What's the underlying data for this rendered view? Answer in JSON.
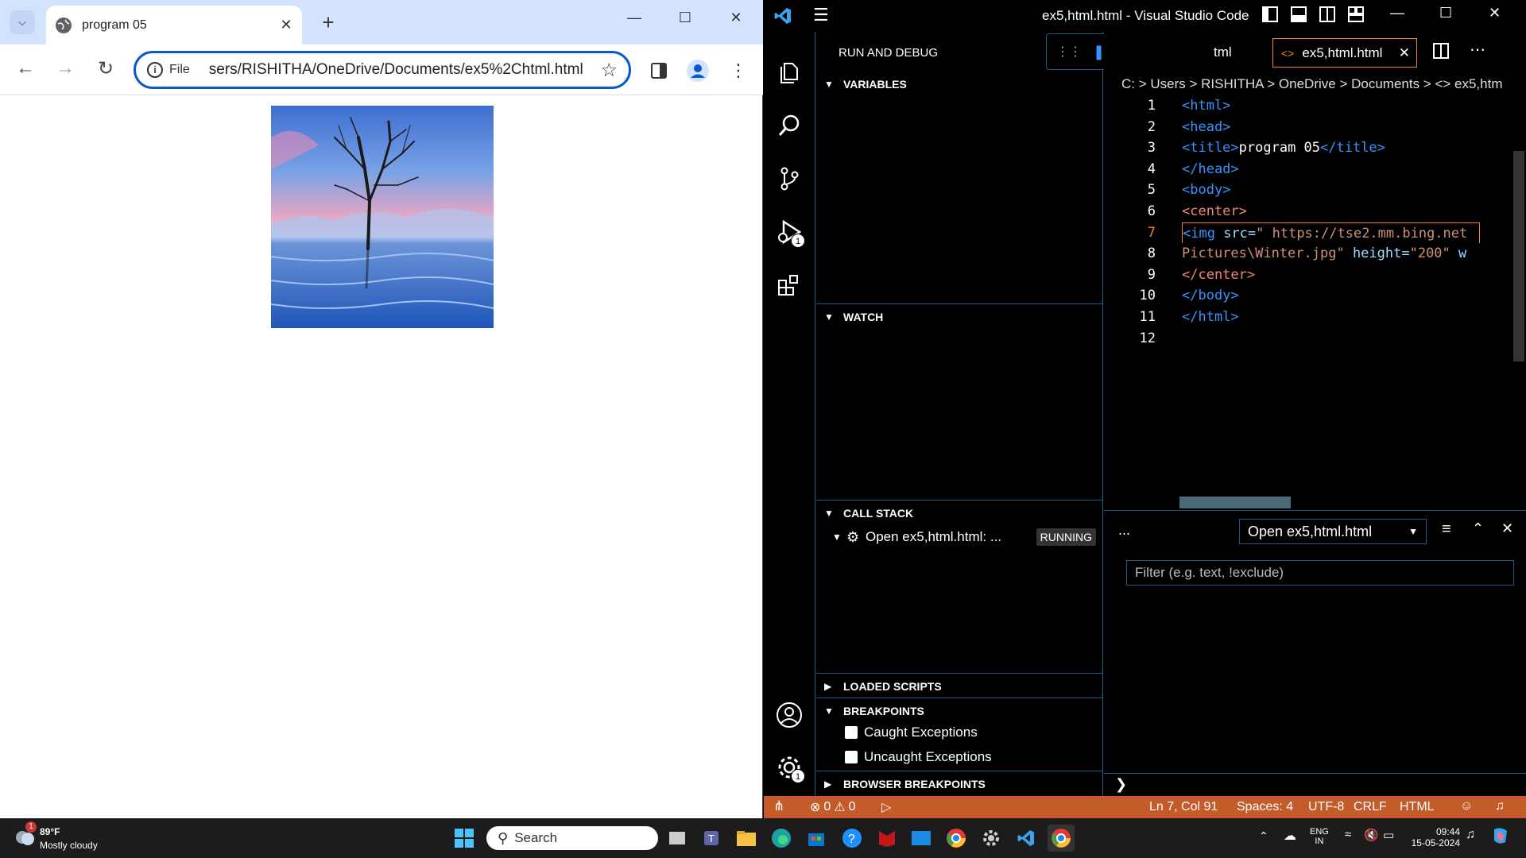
{
  "browser": {
    "tab_title": "program 05",
    "address_prefix": "File",
    "url": "sers/RISHITHA/OneDrive/Documents/ex5%2Chtml.html"
  },
  "vscode": {
    "window_title": "ex5,html.html - Visual Studio Code",
    "sidebar_title": "RUN AND DEBUG",
    "sections": {
      "variables": "VARIABLES",
      "watch": "WATCH",
      "call_stack": "CALL STACK",
      "loaded_scripts": "LOADED SCRIPTS",
      "breakpoints": "BREAKPOINTS",
      "browser_breakpoints": "BROWSER BREAKPOINTS"
    },
    "call_stack_item": "Open ex5,html.html: ...",
    "call_stack_status": "RUNNING",
    "breakpoint_options": [
      "Caught Exceptions",
      "Uncaught Exceptions"
    ],
    "editor_tab_partial": "tml",
    "editor_tab": "ex5,html.html",
    "breadcrumb": "C: > Users > RISHITHA > OneDrive > Documents > <> ex5,htm",
    "line_numbers": [
      "1",
      "2",
      "3",
      "4",
      "5",
      "6",
      "7",
      "8",
      "9",
      "10",
      "11",
      "12"
    ],
    "code": {
      "l1": "<html>",
      "l2": "<head>",
      "l3_open": "<title>",
      "l3_text": "program 05",
      "l3_close": "</title>",
      "l4": "</head>",
      "l5": "<body>",
      "l6": "<center>",
      "l7_tag": "<img",
      "l7_attr": " src=",
      "l7_val": "\" https://tse2.mm.bing.net",
      "l8_val": "Pictures\\Winter.jpg\"",
      "l8_attr": " height=",
      "l8_val2": "\"200\"",
      "l8_more": " w",
      "l9": "</center>",
      "l10": "</body>",
      "l11": "</html>",
      "l12": ""
    },
    "panel": {
      "more": "...",
      "dropdown": "Open ex5,html.html",
      "filter_placeholder": "Filter (e.g. text, !exclude)"
    },
    "activity_badges": {
      "debug": "1",
      "settings": "1"
    },
    "status": {
      "errors": "0",
      "warnings": "0",
      "position": "Ln 7, Col 91",
      "spaces": "Spaces: 4",
      "encoding": "UTF-8",
      "eol": "CRLF",
      "language": "HTML"
    }
  },
  "taskbar": {
    "weather_temp": "89°F",
    "weather_desc": "Mostly cloudy",
    "weather_badge": "1",
    "search": "Search",
    "lang1": "ENG",
    "lang2": "IN",
    "time": "09:44",
    "date": "15-05-2024"
  },
  "colors": {
    "statusbar": "#c55a2b",
    "omnibox_border": "#0b57d0",
    "focus_border": "#f38518",
    "html_tag": "#3794ff"
  }
}
